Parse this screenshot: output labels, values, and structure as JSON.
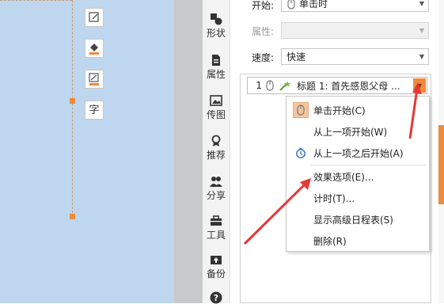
{
  "colors": {
    "accent": "#f08a3c",
    "arrow": "#e53935",
    "canvas": "#bfd6ef"
  },
  "floating_toolbar": {
    "icons": [
      "crop-icon",
      "fill-color-icon",
      "line-color-icon",
      "text-icon"
    ],
    "text_tool_label": "字"
  },
  "sidebar": {
    "items": [
      {
        "label": "形状",
        "icon": "shapes-icon"
      },
      {
        "label": "属性",
        "icon": "properties-icon"
      },
      {
        "label": "传图",
        "icon": "upload-image-icon"
      },
      {
        "label": "推荐",
        "icon": "recommend-icon"
      },
      {
        "label": "分享",
        "icon": "share-icon"
      },
      {
        "label": "工具",
        "icon": "toolbox-icon"
      },
      {
        "label": "备份",
        "icon": "backup-icon"
      },
      {
        "label": "",
        "icon": "help-icon"
      }
    ]
  },
  "panel": {
    "start_label": "开始:",
    "start_value": "单击时",
    "property_label": "属性:",
    "property_value": "",
    "speed_label": "速度:",
    "speed_value": "快速",
    "animation_item": {
      "number": "1",
      "title": "标题 1: 首先感恩父母 ..."
    }
  },
  "context_menu": {
    "items": [
      {
        "label": "单击开始(C)",
        "icon": "mouse-click-icon"
      },
      {
        "label": "从上一项开始(W)",
        "icon": ""
      },
      {
        "label": "从上一项之后开始(A)",
        "icon": "clock-icon"
      },
      {
        "label": "效果选项(E)...",
        "icon": ""
      },
      {
        "label": "计时(T)...",
        "icon": ""
      },
      {
        "label": "显示高级日程表(S)",
        "icon": ""
      },
      {
        "label": "删除(R)",
        "icon": ""
      }
    ]
  }
}
